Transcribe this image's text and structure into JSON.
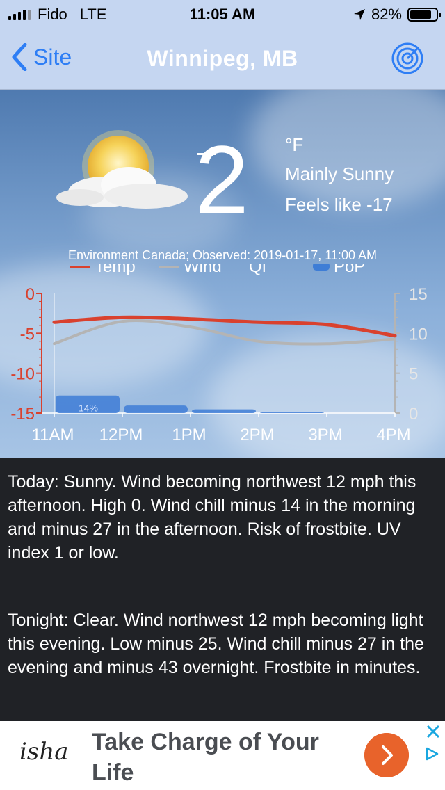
{
  "status": {
    "carrier": "Fido",
    "network": "LTE",
    "time": "11:05 AM",
    "battery": "82%",
    "battery_level": 0.82,
    "signal_bars": 4
  },
  "nav": {
    "back_label": "Site",
    "title": "Winnipeg, MB",
    "radar_icon": "radar-icon"
  },
  "current": {
    "temperature": "2",
    "unit": "°F",
    "condition": "Mainly Sunny",
    "feels_like": "Feels like -17",
    "observed": "Environment Canada; Observed: 2019-01-17, 11:00 AM",
    "icon": "partly-sunny-icon"
  },
  "chart_data": {
    "type": "line",
    "legend": [
      "Temp",
      "Wind",
      "Qf",
      "PoP"
    ],
    "categories": [
      "11AM",
      "12PM",
      "1PM",
      "2PM",
      "3PM",
      "4PM"
    ],
    "left_axis": {
      "ticks": [
        "0",
        "-5",
        "-10",
        "-15"
      ],
      "range": [
        -15,
        0
      ]
    },
    "right_axis": {
      "ticks": [
        "15",
        "10",
        "5",
        "0"
      ],
      "range": [
        0,
        15
      ]
    },
    "series": [
      {
        "name": "Temp",
        "axis": "left",
        "color": "#d9412e",
        "values": [
          -3.6,
          -3.0,
          -3.2,
          -3.6,
          -3.9,
          -5.3
        ]
      },
      {
        "name": "Wind",
        "axis": "right",
        "color": "#b4b4b4",
        "values": [
          8.7,
          11.5,
          10.8,
          9.0,
          8.7,
          9.3
        ]
      },
      {
        "name": "PoP",
        "type": "bar",
        "color": "#3e7dd6",
        "values": [
          14,
          6,
          3,
          1,
          0,
          0
        ]
      }
    ],
    "bar_labels": [
      "14%"
    ]
  },
  "forecast": {
    "today": "Today:  Sunny. Wind becoming northwest 12 mph this afternoon. High 0. Wind chill minus 14 in the morning and minus 27 in the afternoon. Risk of frostbite. UV index 1 or low.",
    "tonight": "Tonight:  Clear. Wind northwest 12 mph becoming light this evening. Low minus 25. Wind chill minus 27 in the evening and minus 43 overnight. Frostbite in minutes."
  },
  "ad": {
    "logo": "isha",
    "headline": "Take Charge of Your Life",
    "accent": "#e8632b"
  }
}
